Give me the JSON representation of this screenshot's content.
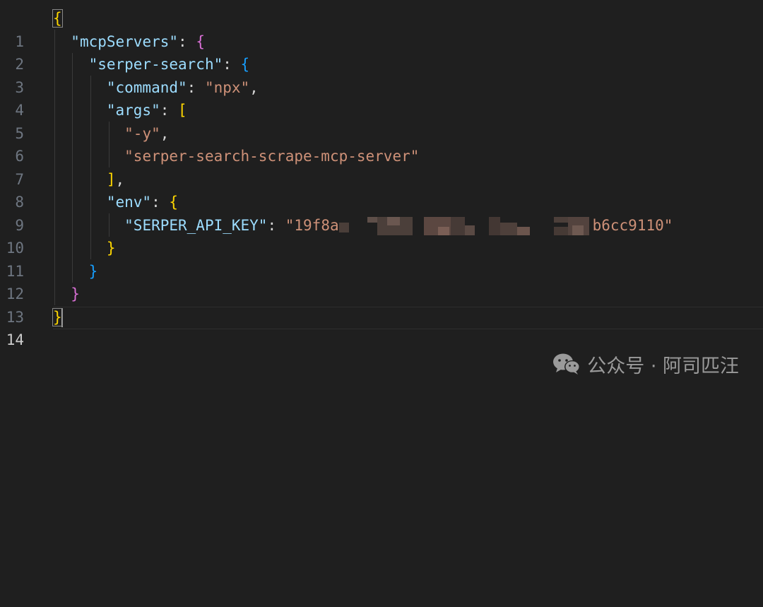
{
  "editor": {
    "active_line": 14,
    "lines": [
      {
        "n": "1"
      },
      {
        "n": "2"
      },
      {
        "n": "3"
      },
      {
        "n": "4"
      },
      {
        "n": "5"
      },
      {
        "n": "6"
      },
      {
        "n": "7"
      },
      {
        "n": "8"
      },
      {
        "n": "9"
      },
      {
        "n": "10"
      },
      {
        "n": "11"
      },
      {
        "n": "12"
      },
      {
        "n": "13"
      },
      {
        "n": "14"
      }
    ],
    "tokens": {
      "l1_open": "{",
      "l2_key": "\"mcpServers\"",
      "l2_colon": ": ",
      "l2_open": "{",
      "l3_key": "\"serper-search\"",
      "l3_colon": ": ",
      "l3_open": "{",
      "l4_key": "\"command\"",
      "l4_colon": ": ",
      "l4_val": "\"npx\"",
      "l4_comma": ",",
      "l5_key": "\"args\"",
      "l5_colon": ": ",
      "l5_open": "[",
      "l6_val": "\"-y\"",
      "l6_comma": ",",
      "l7_val": "\"serper-search-scrape-mcp-server\"",
      "l8_close": "]",
      "l8_comma": ",",
      "l9_key": "\"env\"",
      "l9_colon": ": ",
      "l9_open": "{",
      "l10_key": "\"SERPER_API_KEY\"",
      "l10_colon": ": ",
      "l10_val_start": "\"19f8a",
      "l10_val_end": "b6cc9110\"",
      "l11_close": "}",
      "l12_close": "}",
      "l13_close": "}",
      "l14_close": "}"
    }
  },
  "watermark": {
    "icon": "wechat-icon",
    "text": "公众号 · 阿司匹汪"
  }
}
